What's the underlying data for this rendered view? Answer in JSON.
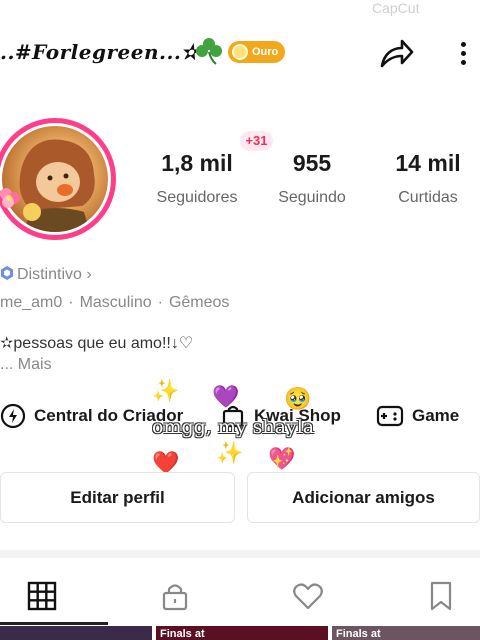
{
  "watermark": "CapCut",
  "header": {
    "username": "..#Forlegreen...✫",
    "badge_label": "Ouro"
  },
  "profile": {
    "new_followers_badge": "+31",
    "stats": [
      {
        "value": "1,8 mil",
        "label": "Seguidores"
      },
      {
        "value": "955",
        "label": "Seguindo"
      },
      {
        "value": "14 mil",
        "label": "Curtidas"
      }
    ],
    "distintivo": "Distintivo",
    "handle": "me_am0",
    "gender": "Masculino",
    "sign": "Gêmeos",
    "bio": "✫pessoas que eu amo!!↓♡",
    "bio_more": "... Mais"
  },
  "shortcuts": {
    "creator": "Central do Criador",
    "shop": "Kwai Shop",
    "game": "Game"
  },
  "overlay": {
    "caption": "omgg, my shayla",
    "sparkle": "✨",
    "heart_purple": "💜",
    "heart_pink": "💖",
    "heart_red": "❤️",
    "face": "🥹"
  },
  "actions": {
    "edit_profile": "Editar perfil",
    "add_friends": "Adicionar amigos"
  },
  "tabs": {
    "icons": [
      "grid-icon",
      "lock-icon",
      "heart-icon",
      "bookmark-icon"
    ],
    "active_index": 0
  },
  "thumbnails": {
    "labels": [
      "Finals at",
      "Finals at"
    ]
  },
  "colors": {
    "avatar_ring": "#ff3e8a",
    "badge_gold": "#f2a81c",
    "new_badge": "#f0305c"
  }
}
